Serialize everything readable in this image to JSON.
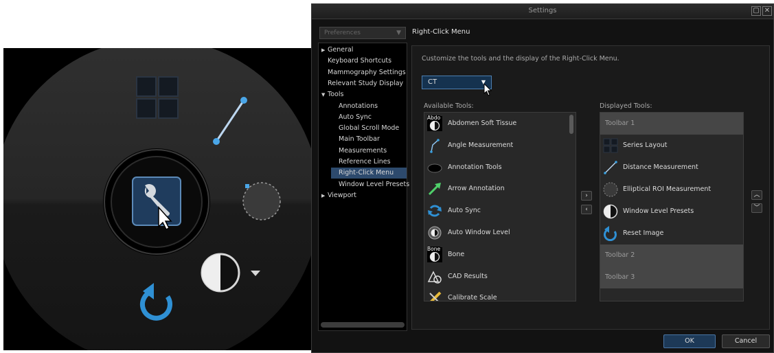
{
  "radial_menu": {
    "items": [
      {
        "name": "series-layout-icon",
        "label": "Series Layout"
      },
      {
        "name": "distance-measurement-icon",
        "label": "Distance Measurement"
      },
      {
        "name": "elliptical-roi-icon",
        "label": "Elliptical ROI Measurement"
      },
      {
        "name": "window-level-icon",
        "label": "Window Level Presets"
      },
      {
        "name": "reset-image-icon",
        "label": "Reset Image"
      },
      {
        "name": "settings-wrench-icon",
        "label": "Settings"
      }
    ],
    "colors": {
      "accent": "#3aa0e0",
      "bg_outer": "#0e0e0e",
      "bg_ring": "#222222",
      "center_btn": "#1d3a5c"
    }
  },
  "dialog": {
    "title": "Settings",
    "title_buttons": [
      "restore-icon",
      "close-icon"
    ],
    "restore_glyph": "▢",
    "close_glyph": "✕",
    "preferences_select": {
      "value": "Preferences",
      "arrow": "▼"
    },
    "page_heading": "Right-Click Menu",
    "nav_tree": [
      {
        "label": "General",
        "level": 0,
        "expander": "▶",
        "selected": false
      },
      {
        "label": "Keyboard Shortcuts",
        "level": 0,
        "expander": "",
        "selected": false
      },
      {
        "label": "Mammography Settings",
        "level": 0,
        "expander": "",
        "selected": false
      },
      {
        "label": "Relevant Study Display",
        "level": 0,
        "expander": "",
        "selected": false
      },
      {
        "label": "Tools",
        "level": 0,
        "expander": "▼",
        "selected": false
      },
      {
        "label": "Annotations",
        "level": 1,
        "expander": "",
        "selected": false
      },
      {
        "label": "Auto Sync",
        "level": 1,
        "expander": "",
        "selected": false
      },
      {
        "label": "Global Scroll Mode",
        "level": 1,
        "expander": "",
        "selected": false
      },
      {
        "label": "Main Toolbar",
        "level": 1,
        "expander": "",
        "selected": false
      },
      {
        "label": "Measurements",
        "level": 1,
        "expander": "",
        "selected": false
      },
      {
        "label": "Reference Lines",
        "level": 1,
        "expander": "",
        "selected": false
      },
      {
        "label": "Right-Click Menu",
        "level": 1,
        "expander": "",
        "selected": true
      },
      {
        "label": "Window Level Presets",
        "level": 1,
        "expander": "",
        "selected": false
      },
      {
        "label": "Viewport",
        "level": 0,
        "expander": "▶",
        "selected": false
      }
    ],
    "description": "Customize the tools and the display of the Right-Click Menu.",
    "modality_select": {
      "value": "CT",
      "arrow": "▼"
    },
    "available_tools_label": "Available Tools:",
    "displayed_tools_label": "Displayed Tools:",
    "available_tools": [
      {
        "label": "Abdomen Soft Tissue",
        "icon": "abdo-icon",
        "icon_text": "Abdo"
      },
      {
        "label": "Angle Measurement",
        "icon": "angle-icon",
        "icon_text": ""
      },
      {
        "label": "Annotation Tools",
        "icon": "annotation-icon",
        "icon_text": ""
      },
      {
        "label": "Arrow Annotation",
        "icon": "arrow-icon",
        "icon_text": ""
      },
      {
        "label": "Auto Sync",
        "icon": "auto-sync-icon",
        "icon_text": ""
      },
      {
        "label": "Auto Window Level",
        "icon": "auto-window-level-icon",
        "icon_text": ""
      },
      {
        "label": "Bone",
        "icon": "bone-icon",
        "icon_text": "Bone"
      },
      {
        "label": "CAD Results",
        "icon": "cad-icon",
        "icon_text": ""
      },
      {
        "label": "Calibrate Scale",
        "icon": "calibrate-icon",
        "icon_text": ""
      }
    ],
    "displayed_tools": {
      "toolbar1": "Toolbar 1",
      "toolbar2": "Toolbar 2",
      "toolbar3": "Toolbar 3",
      "items": [
        {
          "label": "Series Layout",
          "icon": "series-layout-icon"
        },
        {
          "label": "Distance Measurement",
          "icon": "distance-icon"
        },
        {
          "label": "Elliptical ROI Measurement",
          "icon": "ellipse-icon"
        },
        {
          "label": "Window Level Presets",
          "icon": "window-level-icon"
        },
        {
          "label": "Reset Image",
          "icon": "reset-icon"
        }
      ]
    },
    "transfer_buttons": {
      "add": "›",
      "remove": "‹"
    },
    "order_buttons": {
      "up": "︿",
      "down": "﹀"
    },
    "ok_label": "OK",
    "cancel_label": "Cancel"
  }
}
